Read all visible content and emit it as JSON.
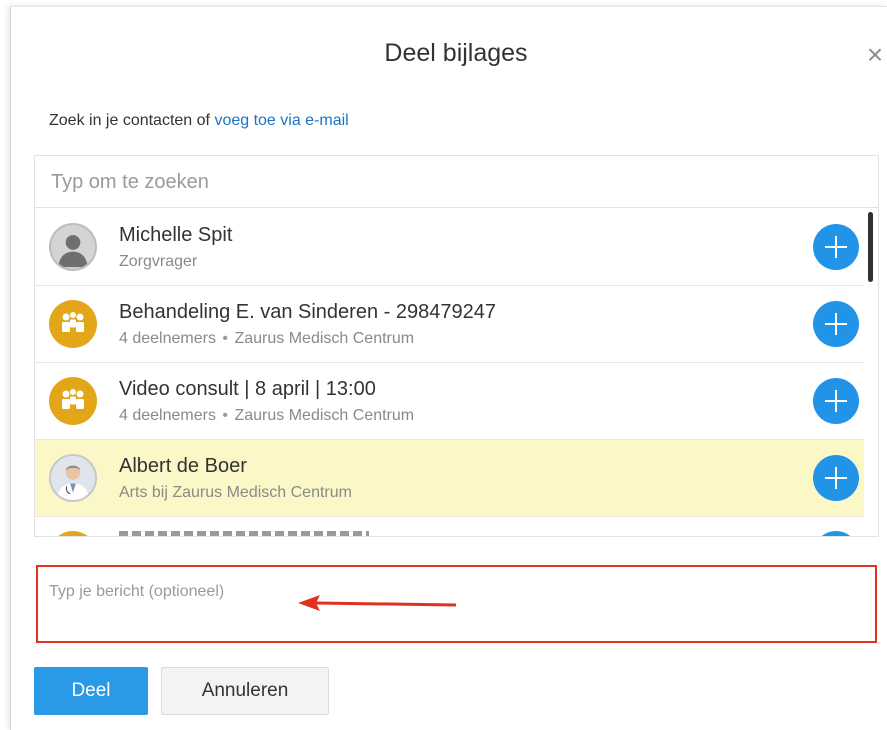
{
  "dialog": {
    "title": "Deel bijlages",
    "close_icon": "close-icon",
    "intro_text": "Zoek in je contacten of ",
    "intro_link": "voeg toe via e-mail"
  },
  "search": {
    "placeholder": "Typ om te zoeken"
  },
  "contacts": [
    {
      "name": "Michelle Spit",
      "sub": "Zorgvrager",
      "avatar": "person-silhouette-icon",
      "highlight": false
    },
    {
      "name": "Behandeling E. van Sinderen - 298479247",
      "sub_count": "4 deelnemers",
      "sub_org": "Zaurus Medisch Centrum",
      "avatar": "group-icon",
      "highlight": false
    },
    {
      "name": "Video consult | 8 april | 13:00",
      "sub_count": "4 deelnemers",
      "sub_org": "Zaurus Medisch Centrum",
      "avatar": "group-icon",
      "highlight": false
    },
    {
      "name": "Albert de Boer",
      "sub": "Arts bij Zaurus Medisch Centrum",
      "avatar": "doctor-photo",
      "highlight": true
    }
  ],
  "message": {
    "placeholder": "Typ je bericht (optioneel)"
  },
  "buttons": {
    "share": "Deel",
    "cancel": "Annuleren"
  },
  "colors": {
    "accent_blue": "#2294e8",
    "link_blue": "#1b74c5",
    "highlight_yellow": "#fbf7c6",
    "group_avatar": "#e3a619",
    "annotation_red": "#e0321f"
  }
}
